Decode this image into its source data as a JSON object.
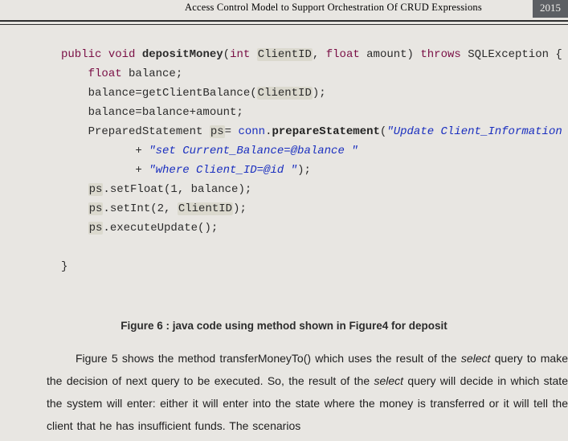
{
  "header": {
    "running_title": "Access Control Model to Support Orchestration Of CRUD Expressions",
    "page_number": "2015"
  },
  "code": {
    "l1a": "public",
    "l1b": " ",
    "l1c": "void",
    "l1d": " ",
    "l1e": "depositMoney",
    "l1f": "(",
    "l1g": "int",
    "l1h": " ",
    "l1i": "ClientID",
    "l1j": ", ",
    "l1k": "float",
    "l1l": " amount) ",
    "l1m": "throws",
    "l1n": " SQLException {",
    "l2a": "    ",
    "l2b": "float",
    "l2c": " balance;",
    "l3a": "    balance=getClientBalance(",
    "l3b": "ClientID",
    "l3c": ");",
    "l4": "    balance=balance+amount;",
    "l5a": "    PreparedStatement ",
    "l5b": "ps",
    "l5c": "= ",
    "l5d": "conn",
    "l5e": ".",
    "l5f": "prepareStatement",
    "l5g": "(",
    "l5h": "\"Update Client_Information \"",
    "l6a": "           + ",
    "l6b": "\"set Current_Balance=@balance \"",
    "l7a": "           + ",
    "l7b": "\"where Client_ID=@id \"",
    "l7c": ");",
    "l8a": "    ",
    "l8b": "ps",
    "l8c": ".setFloat(1, balance);",
    "l9a": "    ",
    "l9b": "ps",
    "l9c": ".setInt(2, ",
    "l9d": "ClientID",
    "l9e": ");",
    "l10a": "    ",
    "l10b": "ps",
    "l10c": ".executeUpdate();",
    "l_blank": "",
    "l_close": "}"
  },
  "caption": "Figure 6 : java code using method shown in Figure4 for deposit",
  "body": {
    "p1a": "Figure 5 shows the method transferMoneyTo() which uses the result of the ",
    "p1b": "select",
    "p1c": " query to make the decision of next query to be executed. So, the result of the ",
    "p1d": "select",
    "p1e": " query will decide in which state the system will enter: either it will enter into the state where the money is transferred or it will tell the client that he has insufficient funds. The scenarios"
  }
}
